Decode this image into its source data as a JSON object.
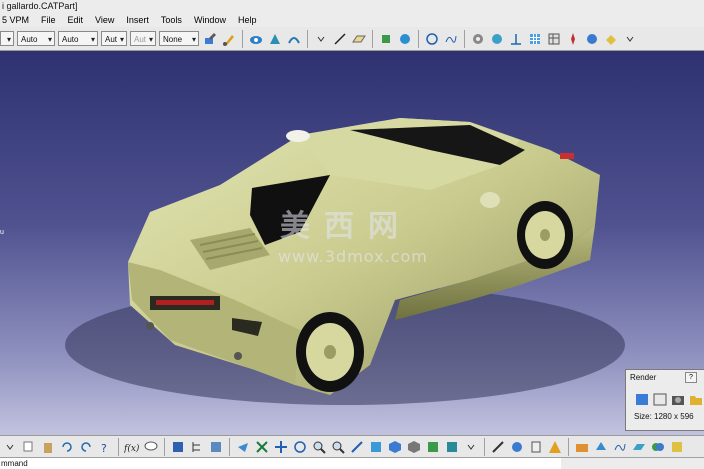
{
  "window": {
    "title": "i gallardo.CATPart]"
  },
  "menu": {
    "items": [
      "5 VPM",
      "File",
      "Edit",
      "View",
      "Insert",
      "Tools",
      "Window",
      "Help"
    ]
  },
  "toolbar": {
    "combo1": "Auto",
    "combo2": "Auto",
    "combo3": "Aut",
    "combo4": "Aut",
    "combo5": "None"
  },
  "viewport": {
    "left_label": "u",
    "watermark_cn": "美西网",
    "watermark_url": "www.3dmox.com"
  },
  "render_panel": {
    "title": "Render",
    "size_label": "Size: 1280 x 596"
  },
  "status": {
    "command_text": "mmand"
  },
  "colors": {
    "car_body": "#c9cb8e",
    "background_top": "#2f3270",
    "background_bottom": "#c2c3df"
  }
}
